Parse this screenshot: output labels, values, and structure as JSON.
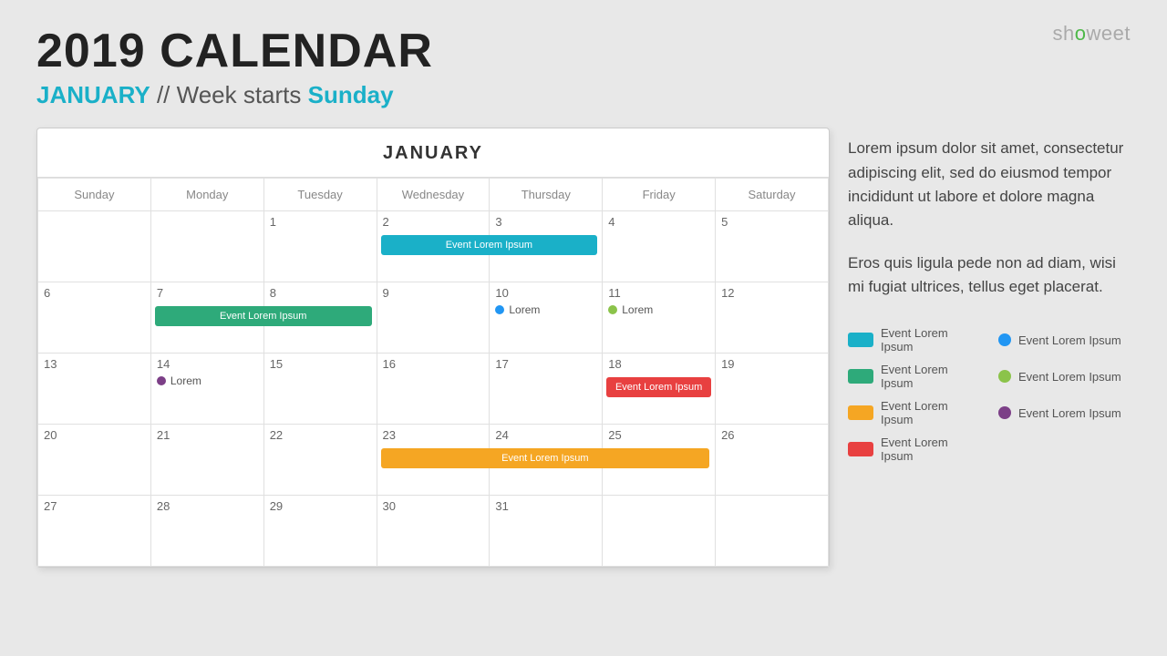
{
  "brand": {
    "prefix": "sh",
    "highlight": "o",
    "suffix": "weet"
  },
  "header": {
    "title": "2019 CALENDAR",
    "month_label": "JANUARY",
    "subtitle_static": "// Week starts",
    "subtitle_day": "Sunday"
  },
  "calendar": {
    "month_name": "JANUARY",
    "days_of_week": [
      "Sunday",
      "Monday",
      "Tuesday",
      "Wednesday",
      "Thursday",
      "Friday",
      "Saturday"
    ],
    "weeks": [
      [
        "",
        "",
        "1",
        "2",
        "3",
        "4",
        "5"
      ],
      [
        "6",
        "7",
        "8",
        "9",
        "10",
        "11",
        "12"
      ],
      [
        "13",
        "14",
        "15",
        "16",
        "17",
        "18",
        "19"
      ],
      [
        "20",
        "21",
        "22",
        "23",
        "24",
        "25",
        "26"
      ],
      [
        "27",
        "28",
        "29",
        "30",
        "31",
        "",
        ""
      ]
    ]
  },
  "events": {
    "bar1": {
      "label": "Event Lorem Ipsum",
      "color": "teal",
      "week": 0,
      "startCol": 3,
      "span": 2
    },
    "bar2": {
      "label": "Event Lorem Ipsum",
      "color": "green",
      "week": 1,
      "startCol": 1,
      "span": 2
    },
    "bar3": {
      "label": "Event Lorem Ipsum",
      "color": "red",
      "week": 2,
      "startCol": 5,
      "span": 1
    },
    "bar4": {
      "label": "Event Lorem Ipsum",
      "color": "orange",
      "week": 3,
      "startCol": 3,
      "span": 3
    }
  },
  "description": {
    "para1": "Lorem ipsum dolor sit amet, consectetur adipiscing elit, sed do eiusmod tempor incididunt ut labore et dolore magna aliqua.",
    "para2": "Eros quis ligula pede non ad diam, wisi mi fugiat ultrices, tellus eget placerat."
  },
  "legend": {
    "items": [
      {
        "label": "Event Lorem Ipsum",
        "type": "bar",
        "color": "teal"
      },
      {
        "label": "Event Lorem Ipsum",
        "type": "dot",
        "color": "blue"
      },
      {
        "label": "Event Lorem Ipsum",
        "type": "bar",
        "color": "green"
      },
      {
        "label": "Event Lorem Ipsum",
        "type": "dot",
        "color": "olive"
      },
      {
        "label": "Event Lorem Ipsum",
        "type": "bar",
        "color": "orange"
      },
      {
        "label": "Event Lorem Ipsum",
        "type": "dot",
        "color": "purple"
      },
      {
        "label": "Event Lorem Ipsum",
        "type": "bar",
        "color": "red"
      }
    ]
  }
}
